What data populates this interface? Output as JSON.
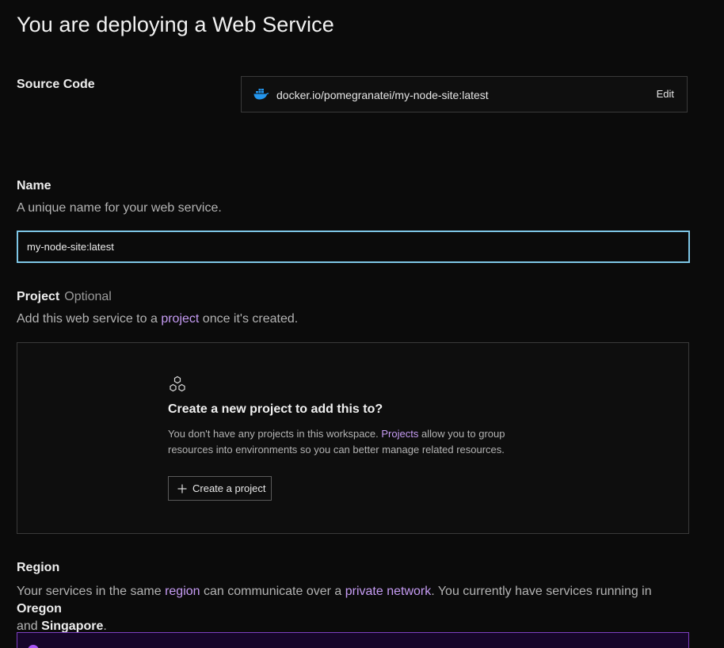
{
  "page": {
    "title": "You are deploying a Web Service"
  },
  "source_code": {
    "label": "Source Code",
    "image": "docker.io/pomegranatei/my-node-site:latest",
    "edit_label": "Edit",
    "icon": "docker-whale-icon"
  },
  "name": {
    "label": "Name",
    "description": "A unique name for your web service.",
    "value": "my-node-site:latest"
  },
  "project": {
    "label": "Project",
    "optional": "Optional",
    "desc_before": "Add this web service to a ",
    "desc_link": "project",
    "desc_after": " once it's created.",
    "empty_title": "Create a new project to add this to?",
    "empty_before": "You don't have any projects in this workspace. ",
    "empty_link": "Projects",
    "empty_after": " allow you to group resources into environments so you can better manage related resources.",
    "create_label": "Create a project"
  },
  "region": {
    "label": "Region",
    "desc_1": "Your services in the same ",
    "link_region": "region",
    "desc_2": " can communicate over a ",
    "link_network": "private network",
    "desc_3": ". You currently have services running in ",
    "oregon": "Oregon",
    "and": " and ",
    "singapore": "Singapore",
    "period": "."
  },
  "colors": {
    "background": "#0b0b0b",
    "link": "#c69cf4",
    "focus": "#7ec6e6",
    "selected_border": "#7d3fc0",
    "docker": "#2496ed"
  }
}
